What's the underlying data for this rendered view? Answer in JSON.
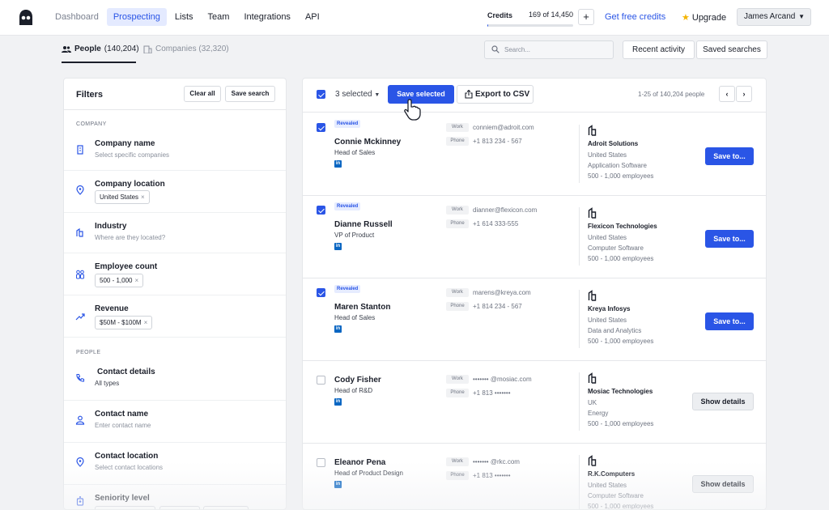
{
  "nav": {
    "links": [
      "Dashboard",
      "Prospecting",
      "Lists",
      "Team",
      "Integrations",
      "API"
    ],
    "active": "Prospecting",
    "credits_label": "Credits",
    "credits_count": "169 of 14,450",
    "credits_fraction": 0.0117,
    "plus": "+",
    "free_credits": "Get free credits",
    "upgrade": "Upgrade",
    "user": "James Arcand",
    "accent": "#2a55e6"
  },
  "subnav": {
    "people_label": "People",
    "people_count": "(140,204)",
    "companies_label": "Companies (32,320)",
    "search_placeholder": "Search...",
    "recent_activity": "Recent activity",
    "saved_searches": "Saved searches"
  },
  "filters": {
    "title": "Filters",
    "clear_all": "Clear all",
    "save_search": "Save search",
    "section_company": "COMPANY",
    "section_people": "PEOPLE",
    "items": [
      {
        "name": "Company name",
        "sub": "Select specific companies",
        "icon": "building-icon"
      },
      {
        "name": "Company location",
        "chip": "United States",
        "icon": "location-pin-icon"
      },
      {
        "name": "Industry",
        "sub": "Where are they located?",
        "icon": "industry-icon"
      },
      {
        "name": "Employee count",
        "chip": "500 - 1,000",
        "icon": "people-icon"
      },
      {
        "name": "Revenue",
        "chip": "$50M - $100M",
        "icon": "trend-icon"
      },
      {
        "name": "Contact details",
        "sub": "All types",
        "icon": "phone-icon"
      },
      {
        "name": "Contact name",
        "sub": "Enter contact name",
        "icon": "person-icon"
      },
      {
        "name": "Contact location",
        "sub": "Select contact locations",
        "icon": "location-pin-icon"
      },
      {
        "name": "Seniority level",
        "icon": "badge-icon"
      }
    ]
  },
  "results": {
    "selected_count": "3 selected",
    "save_selected": "Save selected",
    "export_csv": "Export to CSV",
    "page_info": "1-25 of 140,204 people",
    "prev": "‹",
    "next": "›",
    "work_label": "Work",
    "phone_label": "Phone",
    "revealed_label": "Revealed",
    "linkedin": "in",
    "rows": [
      {
        "checked": true,
        "revealed": true,
        "name": "Connie Mckinney",
        "title": "Head of Sales",
        "email": "conniem@adroit.com",
        "phone": "+1 813 234 - 567",
        "company": "Adroit Solutions",
        "country": "United States",
        "industry": "Application Software",
        "employees": "500 - 1,000 employees",
        "action": "Save to..."
      },
      {
        "checked": true,
        "revealed": true,
        "name": "Dianne Russell",
        "title": "VP of Product",
        "email": "dianner@flexicon.com",
        "phone": "+1 614 333-555",
        "company": "Flexicon Technologies",
        "country": "United States",
        "industry": "Computer Software",
        "employees": "500 - 1,000 employees",
        "action": "Save to..."
      },
      {
        "checked": true,
        "revealed": true,
        "name": "Maren Stanton",
        "title": "Head of Sales",
        "email": "marens@kreya.com",
        "phone": "+1 814 234 - 567",
        "company": "Kreya Infosys",
        "country": "United States",
        "industry": "Data and Analytics",
        "employees": "500 - 1,000 employees",
        "action": "Save to..."
      },
      {
        "checked": false,
        "revealed": false,
        "name": "Cody Fisher",
        "title": "Head of R&D",
        "email": "••••••• @mosiac.com",
        "phone": "+1 813 •••••••",
        "company": "Mosiac Technologies",
        "country": "UK",
        "industry": "Energy",
        "employees": "500 - 1,000 employees",
        "action": "Show details"
      },
      {
        "checked": false,
        "revealed": false,
        "name": "Eleanor Pena",
        "title": "Head of Product Design",
        "email": "••••••• @rkc.com",
        "phone": "+1 813 •••••••",
        "company": "R.K.Computers",
        "country": "United States",
        "industry": "Computer Software",
        "employees": "500 - 1,000 employees",
        "action": "Show details"
      }
    ]
  }
}
